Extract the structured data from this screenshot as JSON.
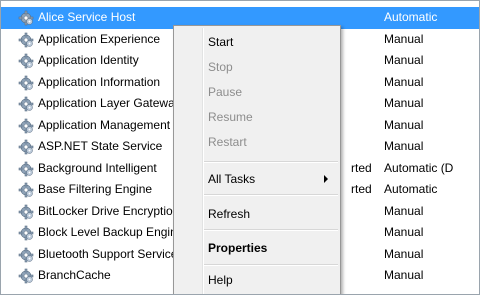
{
  "services": [
    {
      "name": "Alice Service Host",
      "status": "",
      "startup": "Automatic",
      "selected": true
    },
    {
      "name": "Application Experience",
      "status": "",
      "startup": "Manual"
    },
    {
      "name": "Application Identity",
      "status": "",
      "startup": "Manual"
    },
    {
      "name": "Application Information",
      "status": "",
      "startup": "Manual"
    },
    {
      "name": "Application Layer Gateway",
      "status": "",
      "startup": "Manual"
    },
    {
      "name": "Application Management",
      "status": "",
      "startup": "Manual"
    },
    {
      "name": "ASP.NET State Service",
      "status": "",
      "startup": "Manual"
    },
    {
      "name": "Background Intelligent",
      "status": "rted",
      "startup": "Automatic (D"
    },
    {
      "name": "Base Filtering Engine",
      "status": "rted",
      "startup": "Automatic"
    },
    {
      "name": "BitLocker Drive Encryption",
      "status": "",
      "startup": "Manual"
    },
    {
      "name": "Block Level Backup Engine",
      "status": "",
      "startup": "Manual"
    },
    {
      "name": "Bluetooth Support Service",
      "status": "",
      "startup": "Manual"
    },
    {
      "name": "BranchCache",
      "status": "",
      "startup": "Manual"
    }
  ],
  "context_menu": {
    "start": "Start",
    "stop": "Stop",
    "pause": "Pause",
    "resume": "Resume",
    "restart": "Restart",
    "all_tasks": "All Tasks",
    "refresh": "Refresh",
    "properties": "Properties",
    "help": "Help"
  },
  "colors": {
    "selection": "#3399ff",
    "menu_bg": "#f0f0f0",
    "disabled_text": "#8d8d8d"
  },
  "icon": "gear-icon"
}
